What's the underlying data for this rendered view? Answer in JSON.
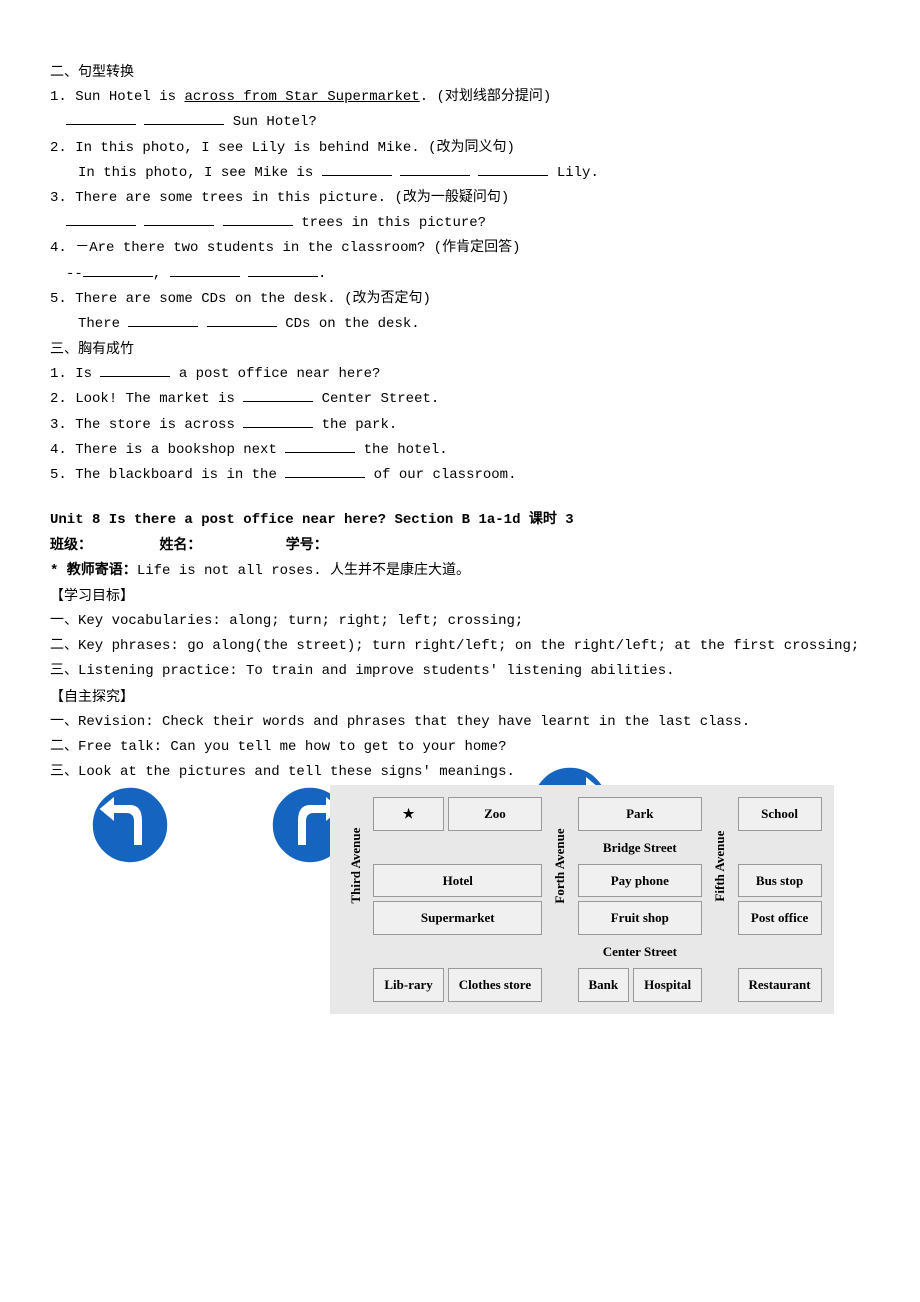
{
  "section2": {
    "title": "二、句型转换",
    "items": [
      {
        "num": "1.",
        "pre": "Sun Hotel is ",
        "underlined": "across from Star Supermarket",
        "post": ". (对划线部分提问)",
        "answer_post": " Sun Hotel?"
      },
      {
        "num": "2.",
        "line1": "In this photo, I see Lily is behind Mike. (改为同义句)",
        "line2_pre": "In this photo, I see Mike is ",
        "line2_post": " Lily."
      },
      {
        "num": "3.",
        "line1": "There are some trees in this picture. (改为一般疑问句)",
        "line2_post": " trees in this picture?"
      },
      {
        "num": "4.",
        "line1": "－Are there two students in the classroom? (作肯定回答)",
        "line2_pre": "--",
        "line2_mid": ", ",
        "line2_post": "."
      },
      {
        "num": "5.",
        "line1": "There are some CDs on the desk. (改为否定句)",
        "line2_pre": "There ",
        "line2_post": " CDs on the desk."
      }
    ]
  },
  "section3": {
    "title": "三、胸有成竹",
    "items": [
      {
        "num": "1.",
        "pre": " Is ",
        "post": " a post office near here?"
      },
      {
        "num": "2.",
        "pre": " Look! The market is ",
        "post": " Center Street."
      },
      {
        "num": "3.",
        "pre": " The store is across ",
        "post": " the park."
      },
      {
        "num": "4.",
        "pre": " There is a bookshop next ",
        "post": " the hotel."
      },
      {
        "num": "5.",
        "pre": " The blackboard is in the ",
        "post": " of our classroom."
      }
    ]
  },
  "unit": {
    "title": "Unit 8 Is there a post office near here? Section B 1a-1d 课时 3",
    "class_label": "班级：",
    "name_label": "姓名：",
    "id_label": "学号：",
    "teacher_prefix": "* 教师寄语：",
    "teacher_msg": "Life is not all roses. 人生并不是康庄大道。",
    "goals_title": "【学习目标】",
    "goals": [
      "一、Key vocabularies: along; turn; right; left; crossing;",
      "二、Key phrases: go along(the street); turn right/left; on the right/left; at the first crossing;",
      "三、Listening practice: To train and improve students'  listening abilities."
    ],
    "explore_title": "【自主探究】",
    "explore": [
      "一、Revision: Check their words and phrases that they have learnt in the last class.",
      "二、Free talk: Can you tell me how to get to your home?",
      "三、Look at the pictures and tell these signs'  meanings."
    ]
  },
  "map": {
    "row1": [
      "★",
      "Zoo",
      "Park",
      "School"
    ],
    "street1": "Bridge Street",
    "row2": [
      "Hotel",
      "Pay phone",
      "Bus stop"
    ],
    "row3": [
      "Supermarket",
      "Fruit shop",
      "Post office"
    ],
    "street2": "Center Street",
    "row4": [
      "Lib-rary",
      "Clothes store",
      "Bank",
      "Hospital",
      "Restaurant"
    ],
    "avenues": [
      "Third Avenue",
      "Forth Avenue",
      "Fifth Avenue"
    ]
  }
}
